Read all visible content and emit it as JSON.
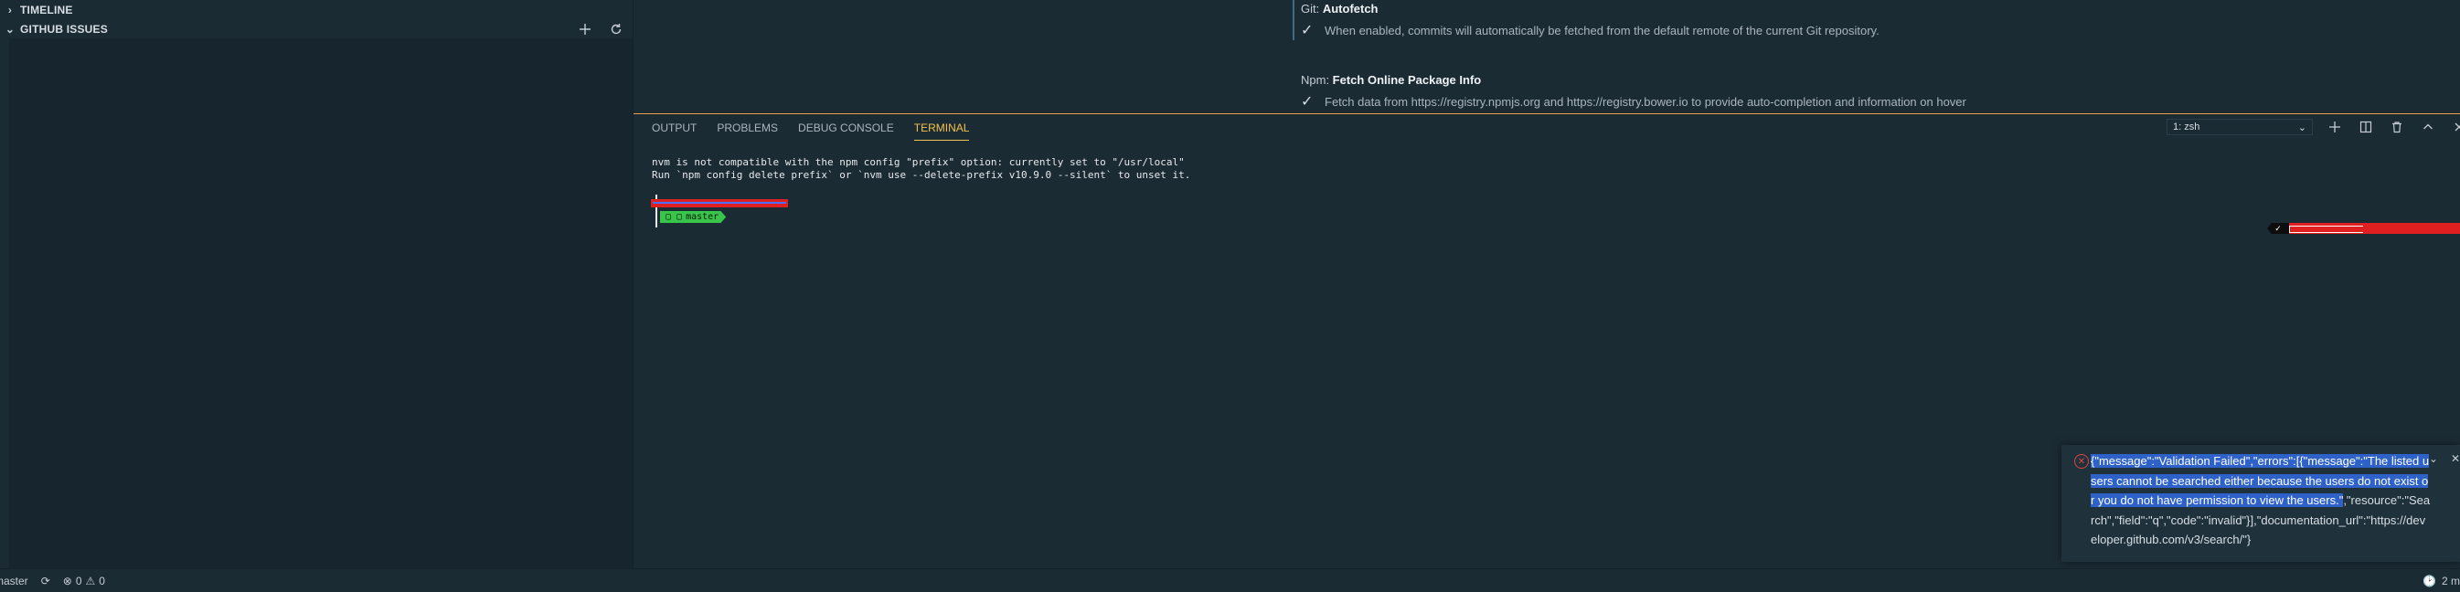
{
  "sidebar": {
    "timeline": "TIMELINE",
    "github_issues": "GITHUB ISSUES"
  },
  "settings": {
    "git": {
      "prefix": "Git: ",
      "name": "Autofetch",
      "description": "When enabled, commits will automatically be fetched from the default remote of the current Git repository."
    },
    "npm": {
      "prefix": "Npm: ",
      "name": "Fetch Online Package Info",
      "description": "Fetch data from https://registry.npmjs.org and https://registry.bower.io to provide auto-completion and information on hover"
    }
  },
  "panel": {
    "tabs": [
      {
        "label": "OUTPUT"
      },
      {
        "label": "PROBLEMS"
      },
      {
        "label": "DEBUG CONSOLE"
      },
      {
        "label": "TERMINAL"
      }
    ],
    "terminal_select": "1: zsh"
  },
  "terminal": {
    "line1": "nvm is not compatible with the npm config \"prefix\" option: currently set to \"/usr/local\"",
    "line2": "Run `npm config delete prefix` or `nvm use --delete-prefix v10.9.0 --silent` to unset it.",
    "branch": "master"
  },
  "notification": {
    "selected": "{\"message\":\"Validation Failed\",\"errors\":[{\"message\":\"The listed users cannot be searched either because the users do not exist or you do not have permission to view the users.\"",
    "rest": ",\"resource\":\"Search\",\"field\":\"q\",\"code\":\"invalid\"}],\"documentation_url\":\"https://developer.github.com/v3/search/\"}"
  },
  "statusbar": {
    "branch": "master",
    "errors": "0",
    "warnings": "0",
    "right": "2 m"
  },
  "colors": {
    "accent": "#f2c14e",
    "error": "#e0453f",
    "selection": "#2f62c9"
  }
}
